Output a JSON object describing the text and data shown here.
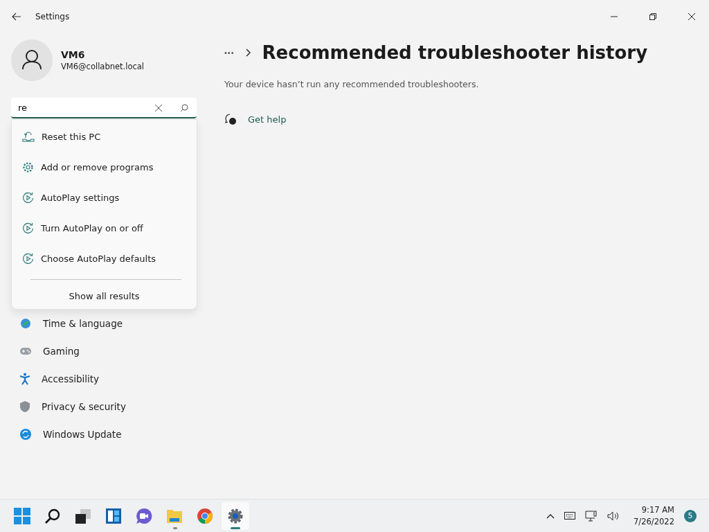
{
  "window": {
    "title": "Settings"
  },
  "profile": {
    "name": "VM6",
    "email": "VM6@collabnet.local"
  },
  "search": {
    "value": "re"
  },
  "suggestions": [
    {
      "label": "Reset this PC",
      "kind": "reset"
    },
    {
      "label": "Add or remove programs",
      "kind": "gear"
    },
    {
      "label": "AutoPlay settings",
      "kind": "autoplay"
    },
    {
      "label": "Turn AutoPlay on or off",
      "kind": "autoplay"
    },
    {
      "label": "Choose AutoPlay defaults",
      "kind": "autoplay"
    }
  ],
  "show_all": "Show all results",
  "nav": [
    {
      "label": "Time & language",
      "kind": "time",
      "selected": false
    },
    {
      "label": "Gaming",
      "kind": "gaming",
      "selected": false
    },
    {
      "label": "Accessibility",
      "kind": "accessibility",
      "selected": false
    },
    {
      "label": "Privacy & security",
      "kind": "privacy",
      "selected": false
    },
    {
      "label": "Windows Update",
      "kind": "update",
      "selected": false
    }
  ],
  "breadcrumb": {
    "more": "•••",
    "title": "Recommended troubleshooter history"
  },
  "message": "Your device hasn’t run any recommended troubleshooters.",
  "get_help": "Get help",
  "taskbar": {
    "apps": [
      {
        "kind": "start",
        "running": false,
        "active": false
      },
      {
        "kind": "search",
        "running": false,
        "active": false
      },
      {
        "kind": "taskview",
        "running": false,
        "active": false
      },
      {
        "kind": "widgets",
        "running": false,
        "active": false
      },
      {
        "kind": "chat",
        "running": false,
        "active": false
      },
      {
        "kind": "explorer",
        "running": true,
        "active": false
      },
      {
        "kind": "chrome",
        "running": false,
        "active": false
      },
      {
        "kind": "settings",
        "running": true,
        "active": true
      }
    ],
    "time": "9:17 AM",
    "date": "7/26/2022",
    "badge": "5"
  }
}
